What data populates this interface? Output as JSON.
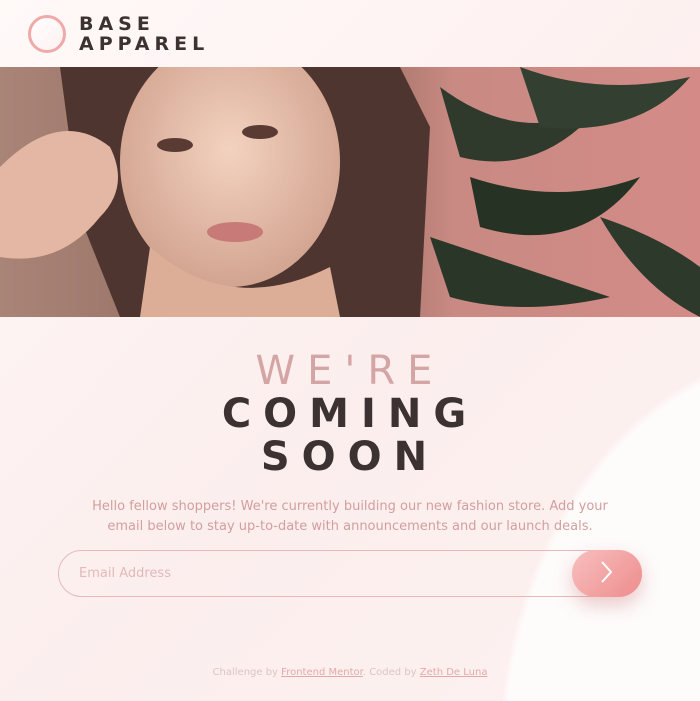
{
  "brand": {
    "logo_line1": "BASE",
    "logo_line2": "APPAREL",
    "icon": "ring-logo-icon"
  },
  "hero": {
    "image_name": "hero-photo"
  },
  "headline": {
    "line1": "WE'RE",
    "line2": "COMING",
    "line3": "SOON"
  },
  "description": "Hello fellow shoppers! We're currently building our new fashion store. Add your email below to stay up-to-date with announcements and our launch deals.",
  "form": {
    "email_placeholder": "Email Address",
    "email_value": "",
    "submit_icon": "chevron-right-icon"
  },
  "attribution": {
    "prefix": "Challenge by",
    "link1": "Frontend Mentor",
    "middle": ". Coded by",
    "link2": "Zeth De Luna"
  },
  "colors": {
    "accent": "#ee8c8c",
    "text_dark": "#3d3232",
    "text_soft": "#d39e9e",
    "background": "#fdf4f3"
  }
}
